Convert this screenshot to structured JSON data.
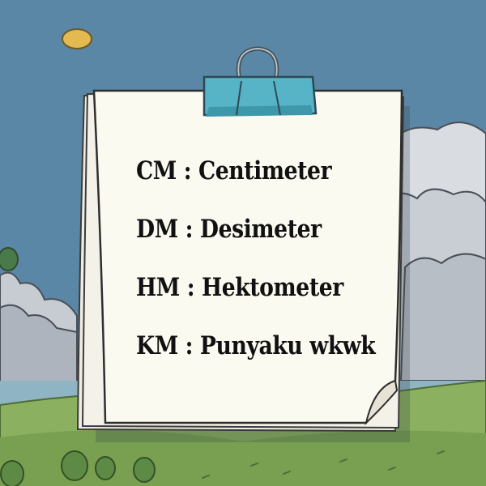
{
  "note": {
    "lines": [
      "CM : Centimeter",
      "DM : Desimeter",
      "HM : Hektometer",
      "KM : Punyaku wkwk"
    ]
  }
}
